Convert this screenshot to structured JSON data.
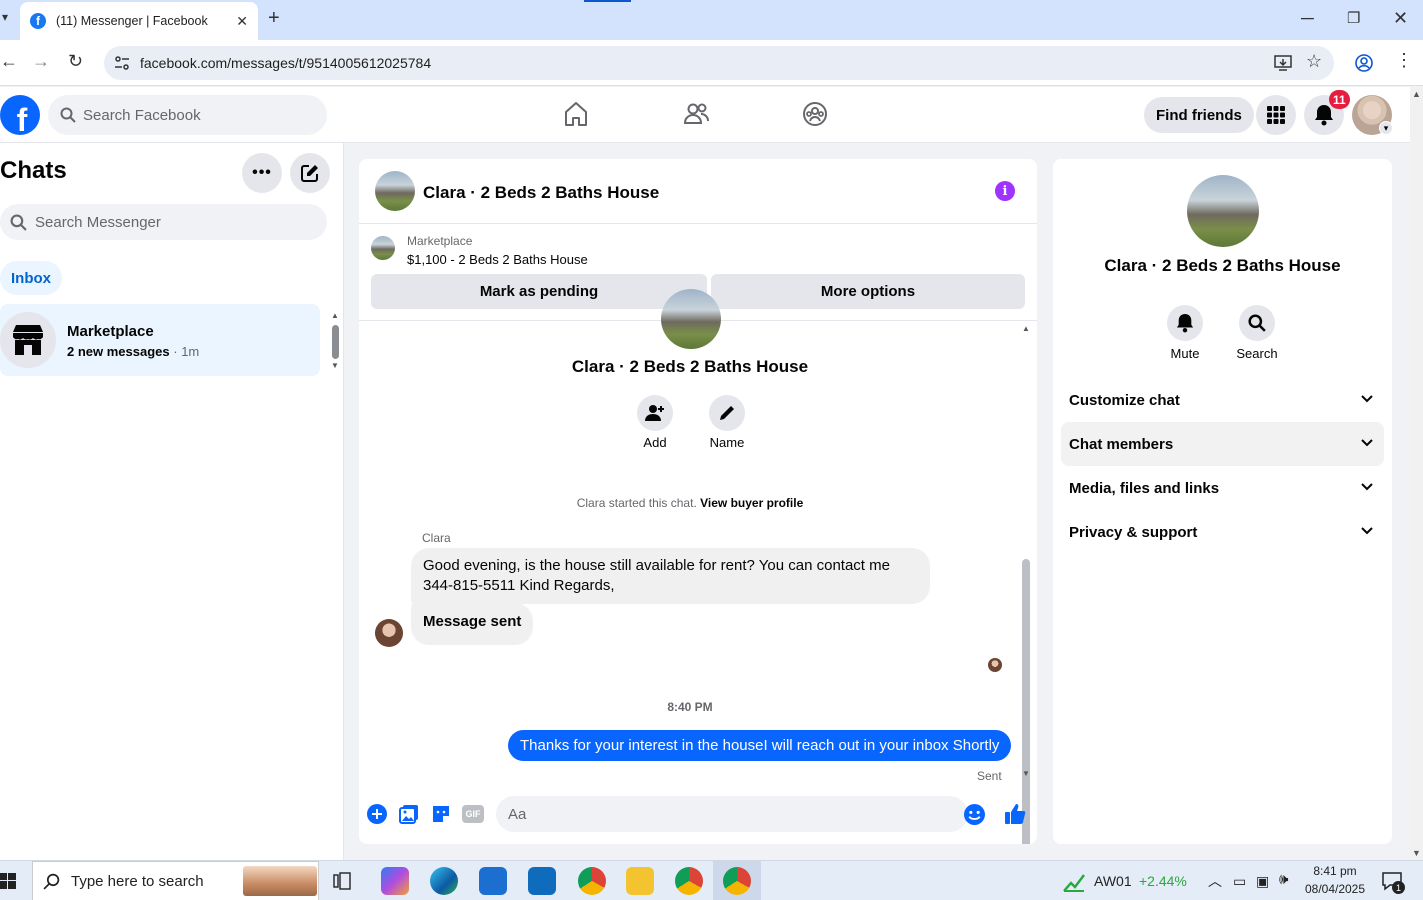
{
  "browser": {
    "tab_title": "(11) Messenger | Facebook",
    "favicon_letter": "f",
    "url": "facebook.com/messages/t/9514005612025784"
  },
  "fb_header": {
    "search_placeholder": "Search Facebook",
    "find_friends_label": "Find friends",
    "notification_count": "11",
    "brand_color": "#0866ff"
  },
  "chats": {
    "title": "Chats",
    "search_placeholder": "Search Messenger",
    "inbox_label": "Inbox",
    "items": [
      {
        "name": "Marketplace",
        "preview": "2 new messages",
        "time": "· 1m"
      }
    ]
  },
  "conversation": {
    "title": "Clara · 2 Beds 2 Baths House",
    "marketplace_label": "Marketplace",
    "listing": "$1,100 - 2 Beds 2 Baths House",
    "mark_pending_label": "Mark as pending",
    "more_options_label": "More options",
    "thread_name": "Clara · 2 Beds 2 Baths House",
    "add_label": "Add",
    "name_label": "Name",
    "started_text": "Clara started this chat.",
    "view_profile_label": "View buyer profile",
    "sender_name": "Clara",
    "messages_in": [
      "Good evening, is the house still available for rent? You can contact me 344-815-5511 Kind Regards,",
      "Message sent"
    ],
    "timestamp": "8:40 PM",
    "message_out": "Thanks for your interest in the houseI will reach out in your inbox Shortly",
    "sent_label": "Sent",
    "composer_placeholder": "Aa"
  },
  "info_panel": {
    "name": "Clara · 2 Beds 2 Baths House",
    "mute_label": "Mute",
    "search_label": "Search",
    "sections": [
      "Customize chat",
      "Chat members",
      "Media, files and links",
      "Privacy & support"
    ]
  },
  "taskbar": {
    "search_placeholder": "Type here to search",
    "stock_name": "AW01",
    "stock_change": "+2.44%",
    "time": "8:41 pm",
    "date": "08/04/2025",
    "notif_count": "1"
  }
}
